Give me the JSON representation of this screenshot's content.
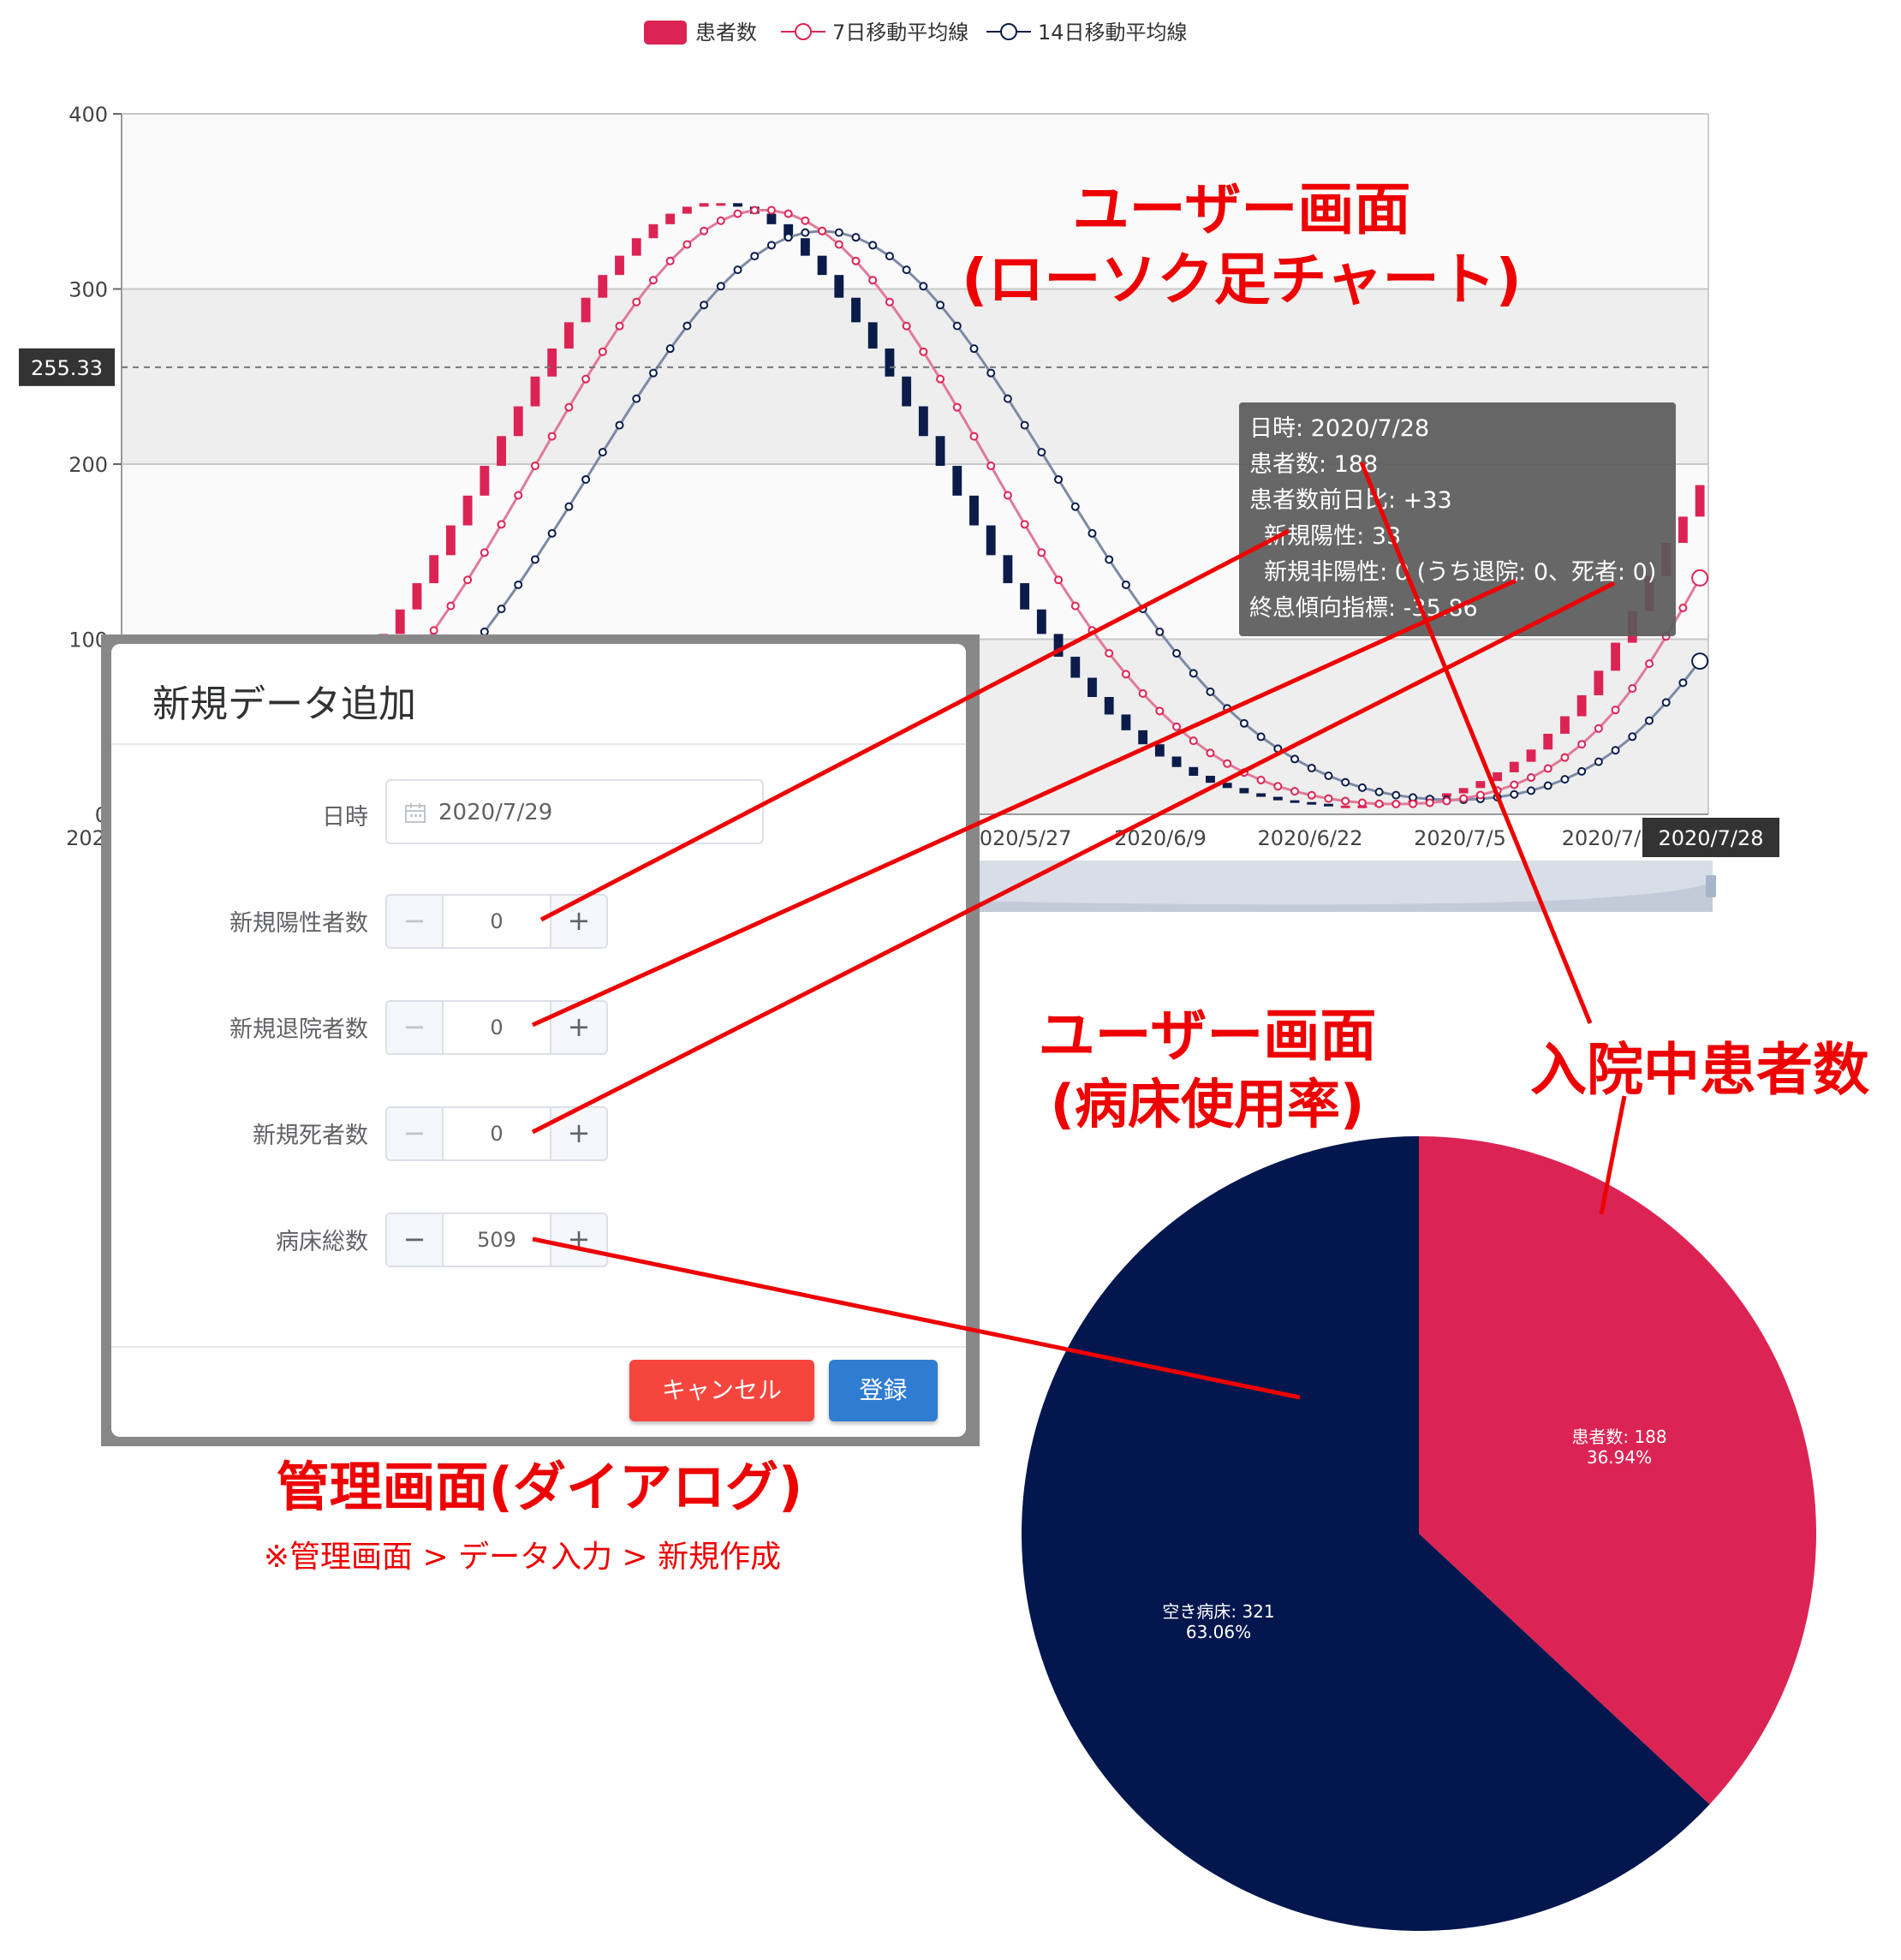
{
  "legend": {
    "items": [
      {
        "label": "患者数",
        "color": "#dc2454"
      },
      {
        "label": "7日移動平均線",
        "color": "#dc2454"
      },
      {
        "label": "14日移動平均線",
        "color": "#0b1c4a"
      }
    ]
  },
  "chart_data": [
    {
      "type": "candlestick",
      "y_ticks": [
        "0",
        "100",
        "200",
        "300",
        "400"
      ],
      "ylim": [
        0,
        400
      ],
      "x_ticks": [
        "202",
        "2020/5/27",
        "2020/6/9",
        "2020/6/22",
        "2020/7/5",
        "2020/7/",
        "2020/7/28"
      ],
      "crosshair_y_label": "255.33",
      "crosshair_x_label": "2020/7/28",
      "grid": true,
      "series": [
        {
          "name": "患者数",
          "color_up": "#dc2454",
          "color_down": "#0b1c4a",
          "values": [
            5,
            7,
            9,
            12,
            15,
            18,
            22,
            27,
            33,
            40,
            48,
            57,
            67,
            78,
            90,
            103,
            117,
            132,
            148,
            165,
            182,
            199,
            216,
            233,
            250,
            266,
            281,
            295,
            308,
            319,
            329,
            337,
            343,
            347,
            349,
            349,
            347,
            343,
            337,
            329,
            319,
            308,
            295,
            281,
            266,
            250,
            233,
            216,
            199,
            182,
            165,
            148,
            132,
            117,
            103,
            90,
            78,
            67,
            57,
            48,
            40,
            33,
            27,
            22,
            18,
            15,
            12,
            10,
            8,
            7,
            6,
            5,
            5,
            5,
            6,
            7,
            8,
            10,
            12,
            15,
            19,
            24,
            30,
            37,
            46,
            56,
            68,
            82,
            98,
            116,
            136,
            155,
            170,
            188
          ]
        },
        {
          "name": "7日移動平均線",
          "color": "#dc2454"
        },
        {
          "name": "14日移動平均線",
          "color": "#0b1c4a"
        }
      ]
    },
    {
      "type": "pie",
      "slices": [
        {
          "label": "患者数: 188",
          "pct": "36.94%",
          "value": 188,
          "color": "#dc2454"
        },
        {
          "label": "空き病床: 321",
          "pct": "63.06%",
          "value": 321,
          "color": "#03174e"
        }
      ]
    }
  ],
  "tooltip": {
    "lines": [
      "日時: 2020/7/28",
      "患者数: 188",
      "患者数前日比: +33",
      "  新規陽性: 33",
      "  新規非陽性: 0 (うち退院: 0、死者: 0)",
      "終息傾向指標: -35.86"
    ]
  },
  "annotations": {
    "candle_title_1": "ユーザー画面",
    "candle_title_2": "(ローソク足チャート)",
    "pie_title_1": "ユーザー画面",
    "pie_title_2": "(病床使用率)",
    "inpatient_label": "入院中患者数",
    "admin_title": "管理画面(ダイアログ)",
    "admin_path": "※管理画面 > データ入力 > 新規作成"
  },
  "dialog": {
    "title": "新規データ追加",
    "date_label": "日時",
    "date_value": "2020/7/29",
    "positive_label": "新規陽性者数",
    "positive_value": "0",
    "discharge_label": "新規退院者数",
    "discharge_value": "0",
    "death_label": "新規死者数",
    "death_value": "0",
    "beds_label": "病床総数",
    "beds_value": "509",
    "cancel_label": "キャンセル",
    "submit_label": "登録"
  },
  "colors": {
    "accent_red": "#dc2454",
    "navy": "#0b1c4a",
    "annotation_red": "#ee0000"
  }
}
